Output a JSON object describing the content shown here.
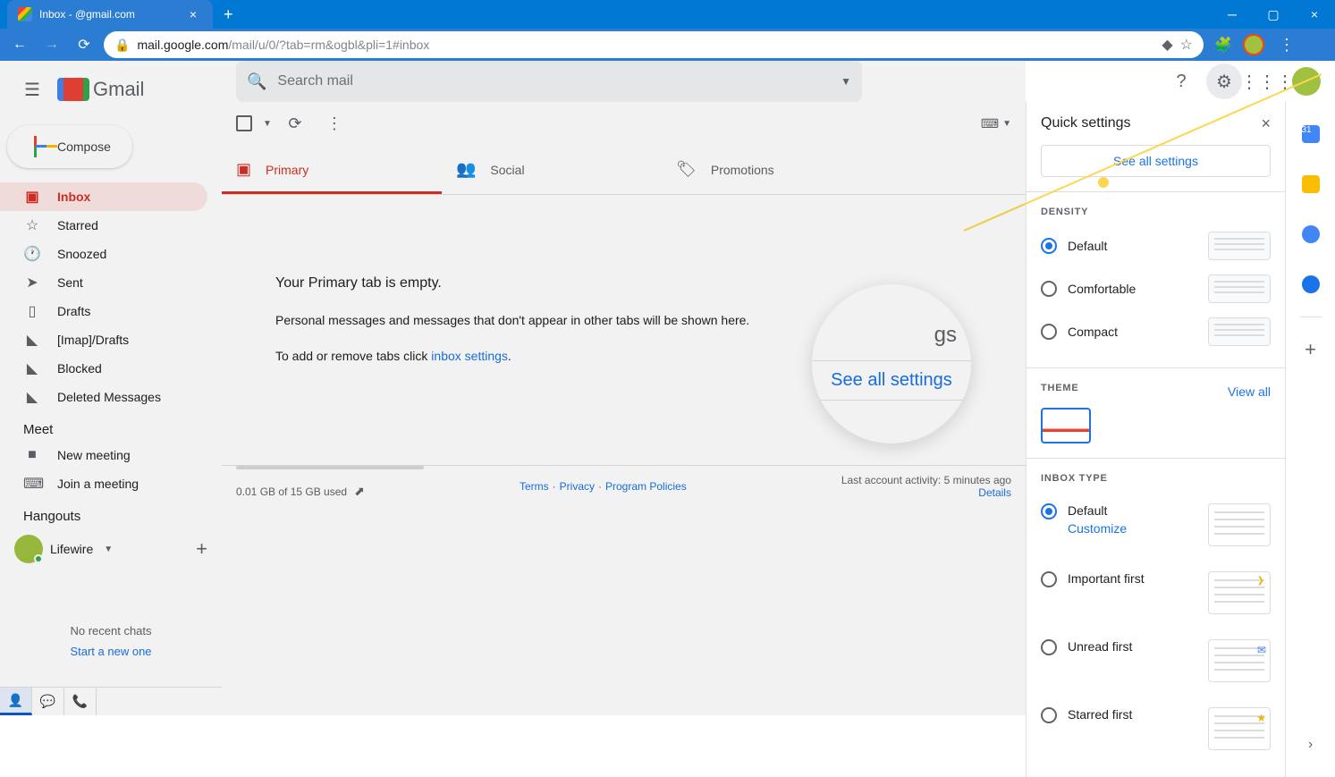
{
  "browser": {
    "tab_title": "Inbox - @gmail.com",
    "url_host": "mail.google.com",
    "url_path": "/mail/u/0/?tab=rm&ogbl&pli=1#inbox"
  },
  "gmail_text": "Gmail",
  "compose_label": "Compose",
  "search_placeholder": "Search mail",
  "nav": {
    "inbox": "Inbox",
    "starred": "Starred",
    "snoozed": "Snoozed",
    "sent": "Sent",
    "drafts": "Drafts",
    "imap": "[Imap]/Drafts",
    "blocked": "Blocked",
    "deleted": "Deleted Messages"
  },
  "meet": {
    "header": "Meet",
    "new": "New meeting",
    "join": "Join a meeting"
  },
  "hangouts": {
    "header": "Hangouts",
    "name": "Lifewire",
    "no_chats": "No recent chats",
    "start": "Start a new one"
  },
  "tabs": {
    "primary": "Primary",
    "social": "Social",
    "promotions": "Promotions"
  },
  "empty": {
    "title": "Your Primary tab is empty.",
    "text": "Personal messages and messages that don't appear in other tabs will be shown here.",
    "add": "To add or remove tabs click ",
    "link": "inbox settings",
    "dot": "."
  },
  "magnify": {
    "top": "gs",
    "main": "See all settings"
  },
  "footer": {
    "storage": "0.01 GB of 15 GB used",
    "terms": "Terms",
    "privacy": "Privacy",
    "policies": "Program Policies",
    "sep": " · ",
    "activity": "Last account activity: 5 minutes ago",
    "details": "Details"
  },
  "qp": {
    "title": "Quick settings",
    "see_all": "See all settings",
    "density_title": "DENSITY",
    "density": {
      "default": "Default",
      "comfortable": "Comfortable",
      "compact": "Compact"
    },
    "theme_title": "THEME",
    "view_all": "View all",
    "inbox_title": "INBOX TYPE",
    "inbox": {
      "default": "Default",
      "customize": "Customize",
      "important": "Important first",
      "unread": "Unread first",
      "starred": "Starred first"
    }
  }
}
